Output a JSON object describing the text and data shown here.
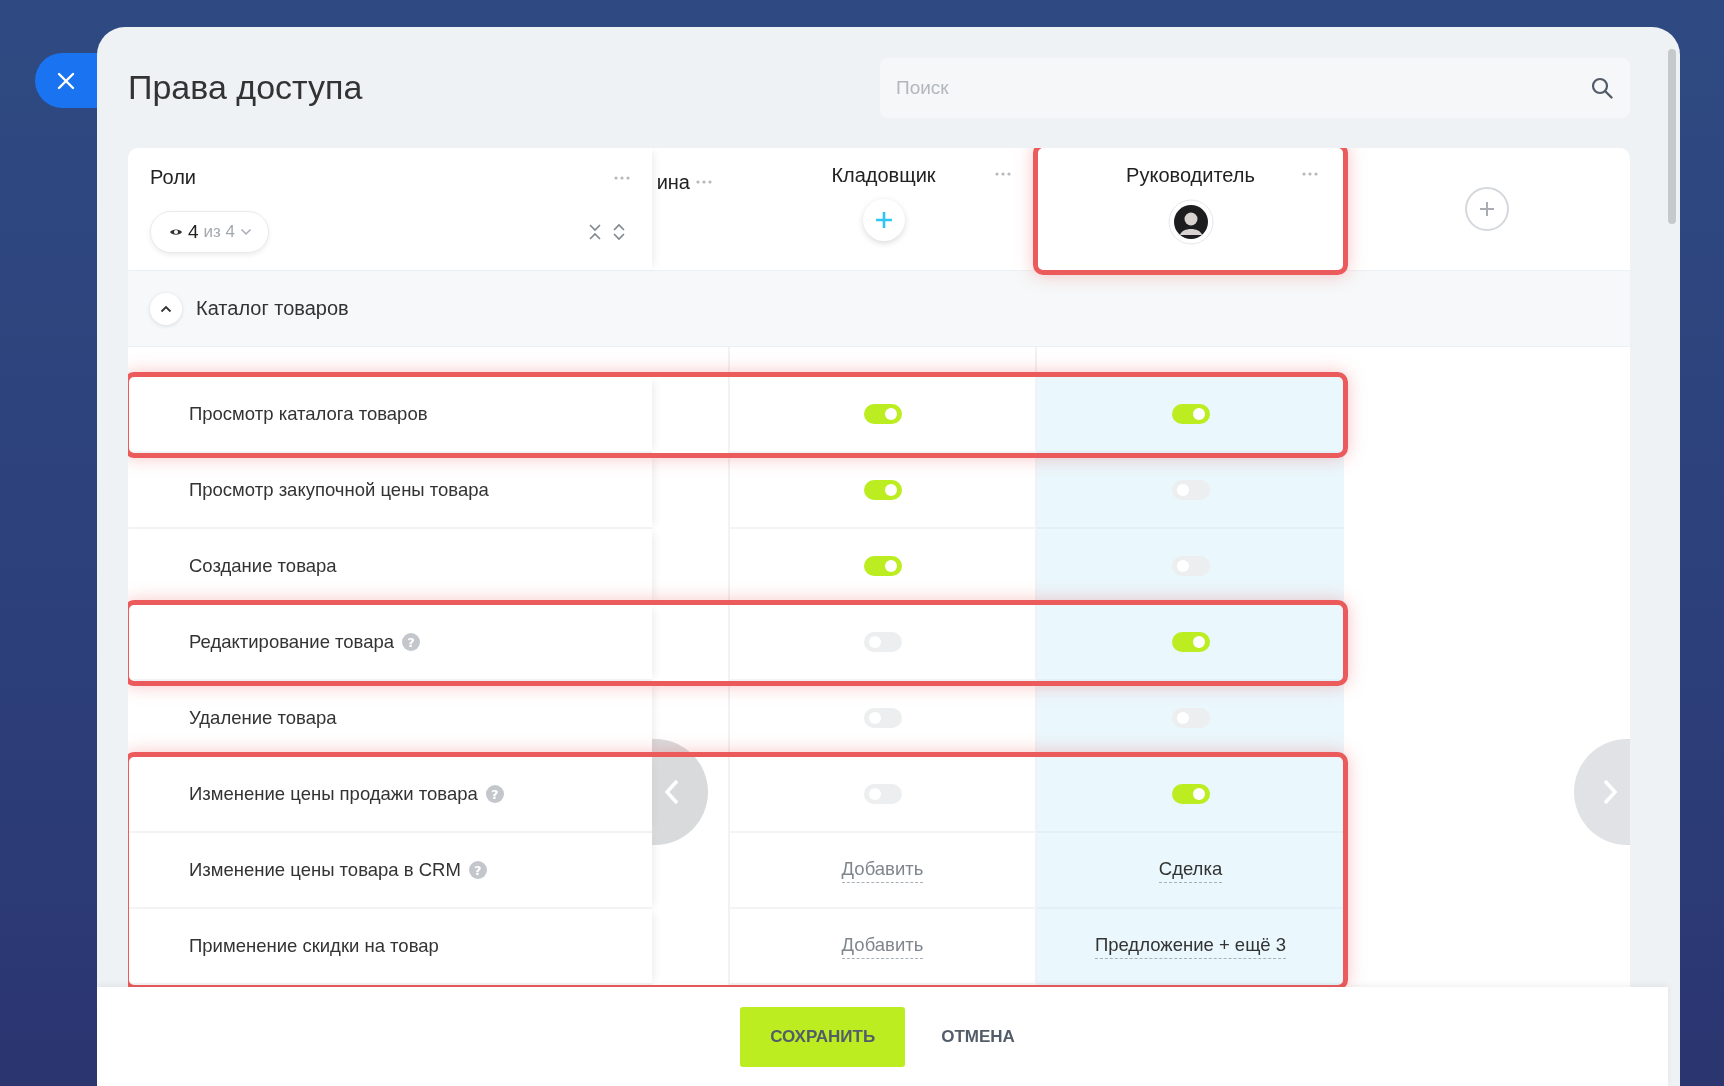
{
  "title": "Права доступа",
  "search": {
    "placeholder": "Поиск"
  },
  "roles_header": {
    "label": "Роли",
    "filter": {
      "shown": "4",
      "total": "из 4"
    }
  },
  "columns": [
    {
      "label": "ина",
      "kind": "partial"
    },
    {
      "label": "Кладовщик",
      "kind": "add",
      "highlighted": false
    },
    {
      "label": "Руководитель",
      "kind": "avatar",
      "highlighted": true
    }
  ],
  "section": {
    "label": "Каталог товаров",
    "expanded": true
  },
  "rows": [
    {
      "label": "Просмотр каталога товаров",
      "highlighted": true,
      "cells": [
        {
          "kind": "toggle",
          "on": true
        },
        {
          "kind": "toggle",
          "on": true
        }
      ]
    },
    {
      "label": "Просмотр закупочной цены товара",
      "highlighted": false,
      "cells": [
        {
          "kind": "toggle",
          "on": true
        },
        {
          "kind": "toggle",
          "on": false
        }
      ]
    },
    {
      "label": "Создание товара",
      "highlighted": false,
      "cells": [
        {
          "kind": "toggle",
          "on": true
        },
        {
          "kind": "toggle",
          "on": false
        }
      ]
    },
    {
      "label": "Редактирование товара",
      "help": "?",
      "highlighted": true,
      "cells": [
        {
          "kind": "toggle",
          "on": false
        },
        {
          "kind": "toggle",
          "on": true
        }
      ]
    },
    {
      "label": "Удаление товара",
      "highlighted": false,
      "cells": [
        {
          "kind": "toggle",
          "on": false
        },
        {
          "kind": "toggle",
          "on": false
        }
      ]
    },
    {
      "label": "Изменение цены продажи товара",
      "help": "?",
      "highlighted": true,
      "cells": [
        {
          "kind": "toggle",
          "on": false
        },
        {
          "kind": "toggle",
          "on": true
        }
      ]
    },
    {
      "label": "Изменение цены товара в CRM",
      "help": "?",
      "highlighted": true,
      "cells": [
        {
          "kind": "link",
          "text": "Добавить",
          "placeholder": true
        },
        {
          "kind": "link",
          "text": "Сделка",
          "placeholder": false
        }
      ]
    },
    {
      "label": "Применение скидки на товар",
      "highlighted": true,
      "cells": [
        {
          "kind": "link",
          "text": "Добавить",
          "placeholder": true
        },
        {
          "kind": "link",
          "text": "Предложение + ещё 3",
          "placeholder": false
        }
      ]
    }
  ],
  "buttons": {
    "save": "СОХРАНИТЬ",
    "cancel": "ОТМЕНА"
  }
}
